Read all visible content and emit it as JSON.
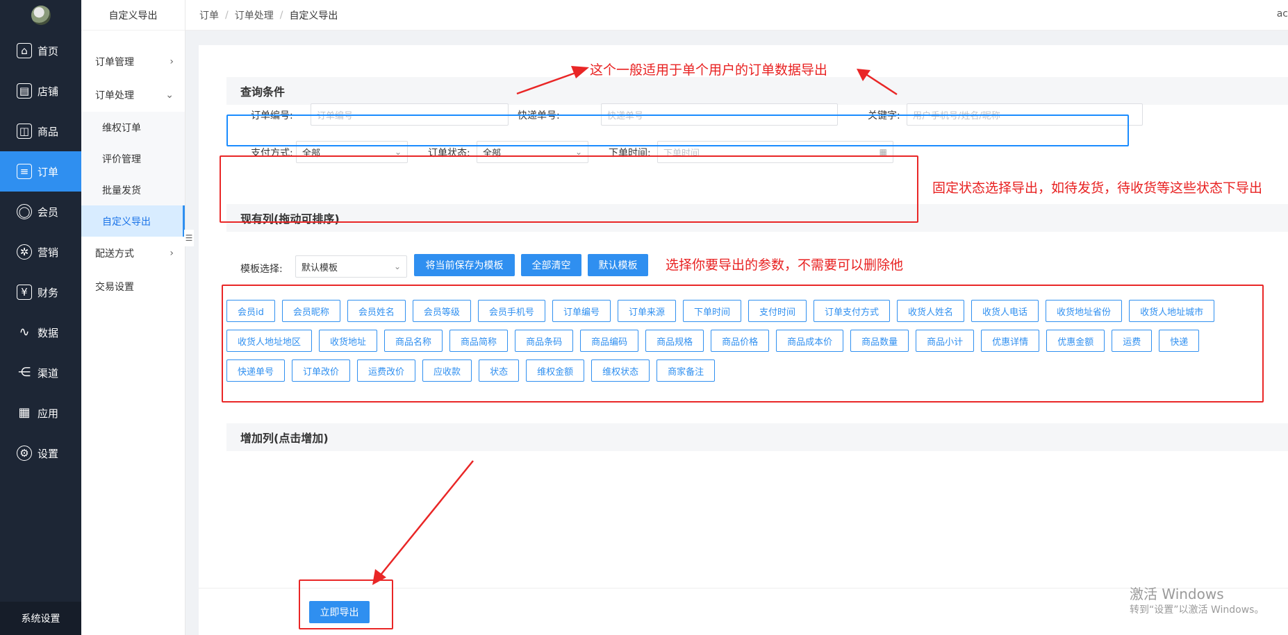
{
  "sidebar": {
    "items": [
      {
        "label": "首页",
        "icon": "home-icon",
        "glyph": "⌂",
        "active": false
      },
      {
        "label": "店铺",
        "icon": "store-icon",
        "glyph": "▤",
        "active": false
      },
      {
        "label": "商品",
        "icon": "bag-icon",
        "glyph": "◫",
        "active": false
      },
      {
        "label": "订单",
        "icon": "order-icon",
        "glyph": "≡",
        "active": true
      },
      {
        "label": "会员",
        "icon": "user-icon",
        "glyph": "◯",
        "active": false
      },
      {
        "label": "营销",
        "icon": "marketing-icon",
        "glyph": "✲",
        "active": false
      },
      {
        "label": "财务",
        "icon": "finance-icon",
        "glyph": "¥",
        "active": false
      },
      {
        "label": "数据",
        "icon": "chart-icon",
        "glyph": "∿",
        "active": false
      },
      {
        "label": "渠道",
        "icon": "share-icon",
        "glyph": "⋲",
        "active": false
      },
      {
        "label": "应用",
        "icon": "apps-icon",
        "glyph": "▦",
        "active": false
      },
      {
        "label": "设置",
        "icon": "gear-icon",
        "glyph": "⚙",
        "active": false
      }
    ],
    "footer_label": "系统设置"
  },
  "subnav": {
    "title": "自定义导出",
    "order_manage": "订单管理",
    "order_process": "订单处理",
    "children": [
      "维权订单",
      "评价管理",
      "批量发货",
      "自定义导出"
    ],
    "delivery": "配送方式",
    "trade_settings": "交易设置",
    "collapse_glyph": "☰"
  },
  "topbar": {
    "breadcrumb": [
      "订单",
      "订单处理",
      "自定义导出"
    ],
    "separator": "/",
    "user": "ac"
  },
  "query": {
    "title": "查询条件",
    "order_no_label": "订单编号:",
    "order_no_placeholder": "订单编号",
    "express_no_label": "快递单号:",
    "express_no_placeholder": "快递单号",
    "keyword_label": "关键字:",
    "keyword_placeholder": "用户手机号/姓名/昵称",
    "pay_method_label": "支付方式:",
    "pay_method_value": "全部",
    "order_status_label": "订单状态:",
    "order_status_value": "全部",
    "order_time_label": "下单时间:",
    "order_time_placeholder": "下单时间"
  },
  "columns": {
    "title": "现有列(拖动可排序)",
    "template_label": "模板选择:",
    "template_value": "默认模板",
    "save_template": "将当前保存为模板",
    "clear_all": "全部清空",
    "default_template": "默认模板",
    "tags": [
      "会员id",
      "会员昵称",
      "会员姓名",
      "会员等级",
      "会员手机号",
      "订单编号",
      "订单来源",
      "下单时间",
      "支付时间",
      "订单支付方式",
      "收货人姓名",
      "收货人电话",
      "收货地址省份",
      "收货人地址城市",
      "收货人地址地区",
      "收货地址",
      "商品名称",
      "商品简称",
      "商品条码",
      "商品编码",
      "商品规格",
      "商品价格",
      "商品成本价",
      "商品数量",
      "商品小计",
      "优惠详情",
      "优惠金额",
      "运费",
      "快递",
      "快递单号",
      "订单改价",
      "运费改价",
      "应收款",
      "状态",
      "维权金额",
      "维权状态",
      "商家备注"
    ]
  },
  "add_columns": {
    "title": "增加列(点击增加)"
  },
  "export_button": "立即导出",
  "annotations": {
    "note_top": "这个一般适用于单个用户的订单数据导出",
    "note_status": "固定状态选择导出，如待发货，待收货等这些状态下导出",
    "note_params": "选择你要导出的参数，不需要可以删除他",
    "color": "#e92626"
  },
  "watermark": {
    "title": "激活 Windows",
    "subtitle": "转到“设置”以激活 Windows。"
  }
}
